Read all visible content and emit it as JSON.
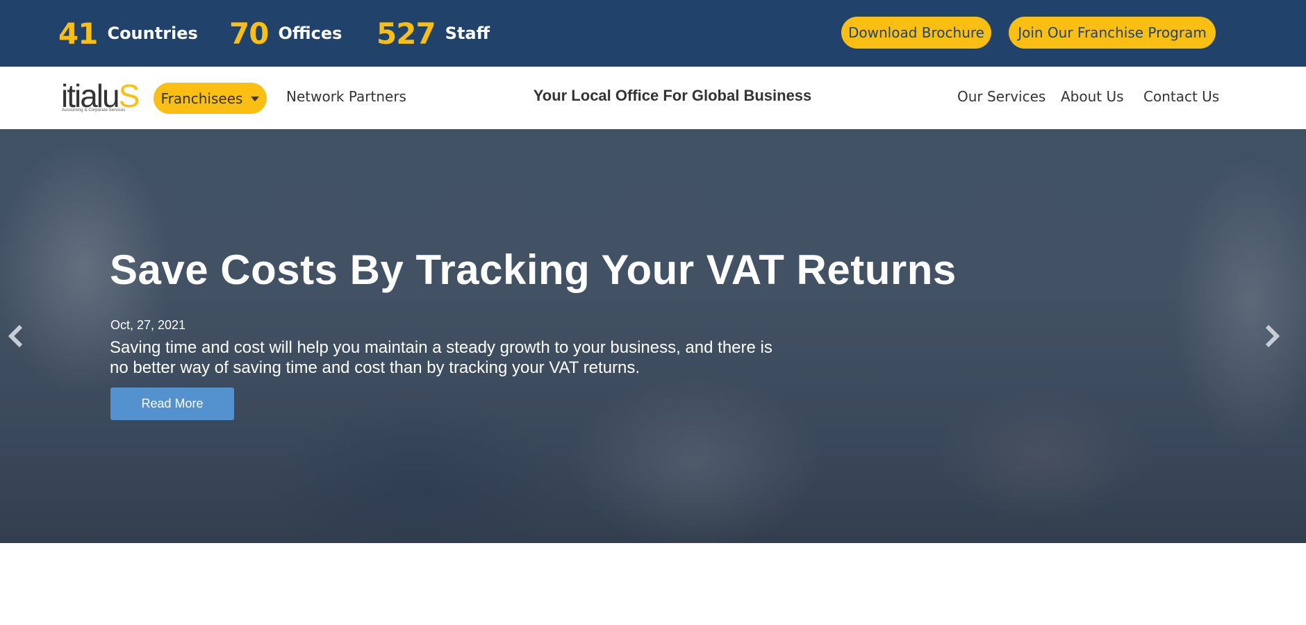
{
  "topbar": {
    "stats": [
      {
        "number": "41",
        "label": "Countries"
      },
      {
        "number": "70",
        "label": "Offices"
      },
      {
        "number": "527",
        "label": "Staff"
      }
    ],
    "download_label": "Download Brochure",
    "join_label": "Join Our Franchise Program"
  },
  "navbar": {
    "logo_text": "itialu",
    "logo_text_accent": "S",
    "logo_sub": "Accounting & Corporate Services",
    "franchisees_label": "Franchisees",
    "network_partners_label": "Network Partners",
    "tagline": "Your Local Office For Global Business",
    "links": [
      "Our Services",
      "About Us",
      "Contact Us"
    ]
  },
  "hero": {
    "title": "Save Costs By Tracking Your VAT Returns",
    "date": "Oct, 27, 2021",
    "description": "Saving time and cost will help you maintain a steady growth to your business, and there is no better way of saving time and cost than by tracking your VAT returns.",
    "read_more_label": "Read More"
  },
  "icons": {
    "prev": "chevron-left-icon",
    "next": "chevron-right-icon",
    "dropdown": "caret-down-icon"
  },
  "colors": {
    "topbar_bg": "#20426b",
    "accent_yellow": "#fbbf14",
    "button_blue": "#5491cf"
  }
}
